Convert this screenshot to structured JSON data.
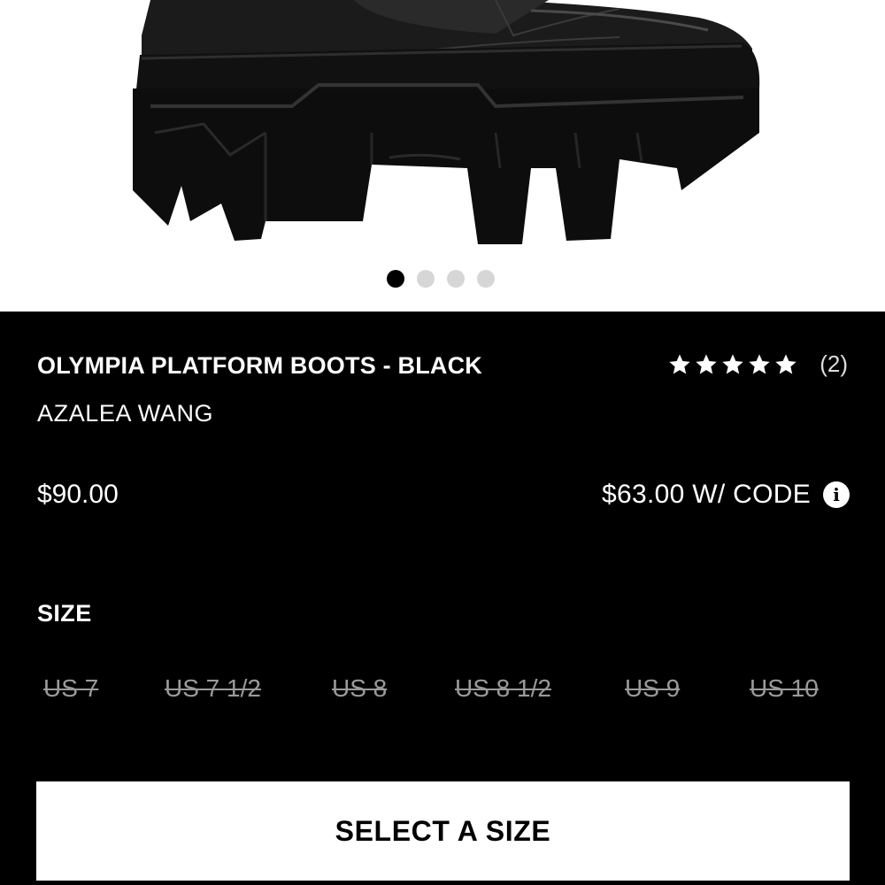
{
  "product": {
    "title": "OLYMPIA PLATFORM BOOTS - BLACK",
    "brand": "AZALEA WANG",
    "image_subject": "black leather platform boot with chunky lug sole",
    "gallery": {
      "count": 4,
      "active_index": 0
    }
  },
  "rating": {
    "stars": 5,
    "count_label": "(2)"
  },
  "pricing": {
    "price": "$90.00",
    "promo": "$63.00 W/ CODE",
    "info_icon": "info-icon"
  },
  "size": {
    "label": "SIZE",
    "options": [
      {
        "label": "US 7",
        "available": false
      },
      {
        "label": "US 7 1/2",
        "available": false
      },
      {
        "label": "US 8",
        "available": false
      },
      {
        "label": "US 8 1/2",
        "available": false
      },
      {
        "label": "US 9",
        "available": false
      },
      {
        "label": "US 10",
        "available": false
      }
    ]
  },
  "cta": {
    "label": "SELECT A SIZE"
  },
  "colors": {
    "background": "#000000",
    "text": "#ffffff",
    "unavailable": "#9a9a9a",
    "button": "#ffffff"
  }
}
